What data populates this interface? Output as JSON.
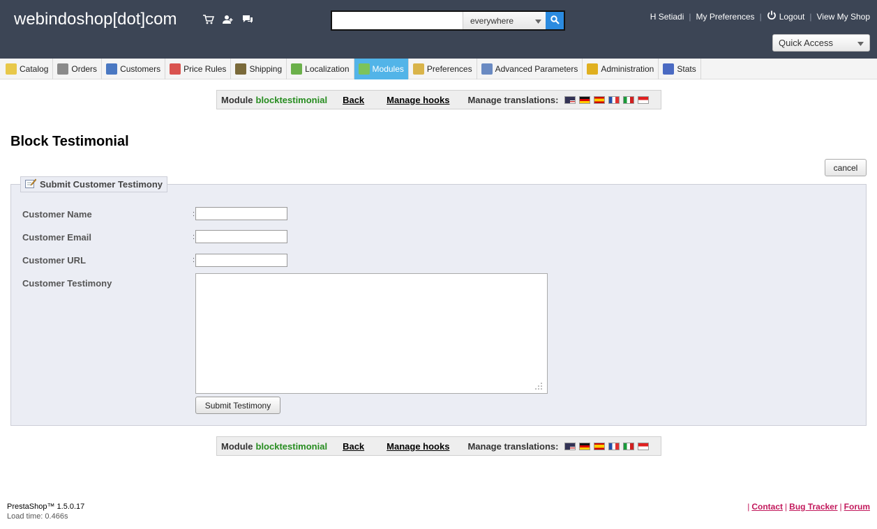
{
  "header": {
    "shop_name": "webindoshop[dot]com",
    "search": {
      "value": "",
      "scope": "everywhere"
    },
    "user": "H Setiadi",
    "my_preferences": "My Preferences",
    "logout": "Logout",
    "view_shop": "View My Shop",
    "quick_access": "Quick Access"
  },
  "menu": {
    "items": [
      {
        "label": "Catalog",
        "icon": "folder-icon",
        "color": "#e8c84a"
      },
      {
        "label": "Orders",
        "icon": "cart-icon",
        "color": "#8a8a8a"
      },
      {
        "label": "Customers",
        "icon": "customer-icon",
        "color": "#4a78c2"
      },
      {
        "label": "Price Rules",
        "icon": "price-tag-icon",
        "color": "#d9534f"
      },
      {
        "label": "Shipping",
        "icon": "truck-icon",
        "color": "#7a6a3a"
      },
      {
        "label": "Localization",
        "icon": "globe-icon",
        "color": "#6bb04a"
      },
      {
        "label": "Modules",
        "icon": "puzzle-icon",
        "color": "#7cc35a"
      },
      {
        "label": "Preferences",
        "icon": "preferences-icon",
        "color": "#d9b44a"
      },
      {
        "label": "Advanced Parameters",
        "icon": "wrench-icon",
        "color": "#6a8ac2"
      },
      {
        "label": "Administration",
        "icon": "key-icon",
        "color": "#e0b020"
      },
      {
        "label": "Stats",
        "icon": "bar-chart-icon",
        "color": "#4a6ac2"
      }
    ],
    "active": "Modules"
  },
  "toolbar": {
    "module_label": "Module",
    "module_name": "blocktestimonial",
    "back": "Back",
    "manage_hooks": "Manage hooks",
    "manage_translations": "Manage translations:",
    "flags": [
      "flag-us-icon",
      "flag-de-icon",
      "flag-es-icon",
      "flag-fr-icon",
      "flag-it-icon",
      "flag-id-icon"
    ]
  },
  "page": {
    "title": "Block Testimonial",
    "cancel": "cancel"
  },
  "form": {
    "legend": "Submit Customer Testimony",
    "name_label": "Customer Name",
    "email_label": "Customer Email",
    "url_label": "Customer URL",
    "testimony_label": "Customer Testimony",
    "colon": ":",
    "name_value": "",
    "email_value": "",
    "url_value": "",
    "testimony_value": "",
    "submit": "Submit Testimony"
  },
  "footer": {
    "version": "PrestaShop™ 1.5.0.17",
    "load_time": "Load time: 0.466s",
    "sep": "|",
    "contact": "Contact",
    "bug_tracker": "Bug Tracker",
    "forum": "Forum"
  }
}
